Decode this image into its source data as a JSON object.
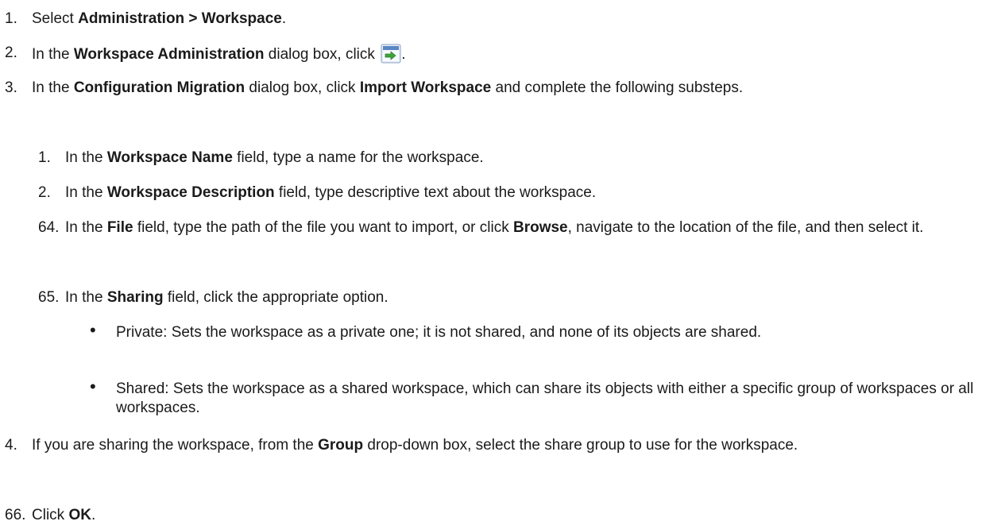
{
  "steps": [
    {
      "num": "1.",
      "a": "Select ",
      "b1": "Administration > Workspace",
      "c": "."
    },
    {
      "num": "2.",
      "a": "In the ",
      "b1": "Workspace Administration",
      "c": " dialog box, click ",
      "d": ".",
      "icon": "import-workspace-icon"
    },
    {
      "num": "3.",
      "a": "In the ",
      "b1": "Configuration Migration",
      "c": " dialog box, click ",
      "b2": "Import Workspace",
      "d": " and complete the following substeps."
    },
    {
      "num": "1.",
      "a": "In the ",
      "b1": "Workspace Name",
      "c": " field, type a name for the workspace."
    },
    {
      "num": "2.",
      "a": "In the ",
      "b1": "Workspace Description",
      "c": " field, type descriptive text about the workspace."
    },
    {
      "num": "64.",
      "a": "In the ",
      "b1": "File",
      "c": " field, type the path of the file you want to import, or click ",
      "b2": "Browse",
      "d": ", navigate to the location of the file, and then select it."
    },
    {
      "num": "65.",
      "a": "In the ",
      "b1": "Sharing",
      "c": " field, click the appropriate option."
    },
    {
      "bullet": "•",
      "text": "Private: Sets the workspace as a private one; it is not shared, and none of its objects are shared."
    },
    {
      "bullet": "•",
      "text": "Shared: Sets the workspace as a shared workspace, which can share its objects with either a specific group of workspaces or all workspaces."
    },
    {
      "num": "4.",
      "a": "If you are sharing the workspace, from the ",
      "b1": "Group",
      "c": " drop-down box, select the share group to use for the workspace."
    },
    {
      "num": "66.",
      "a": "Click ",
      "b1": "OK",
      "c": "."
    }
  ]
}
